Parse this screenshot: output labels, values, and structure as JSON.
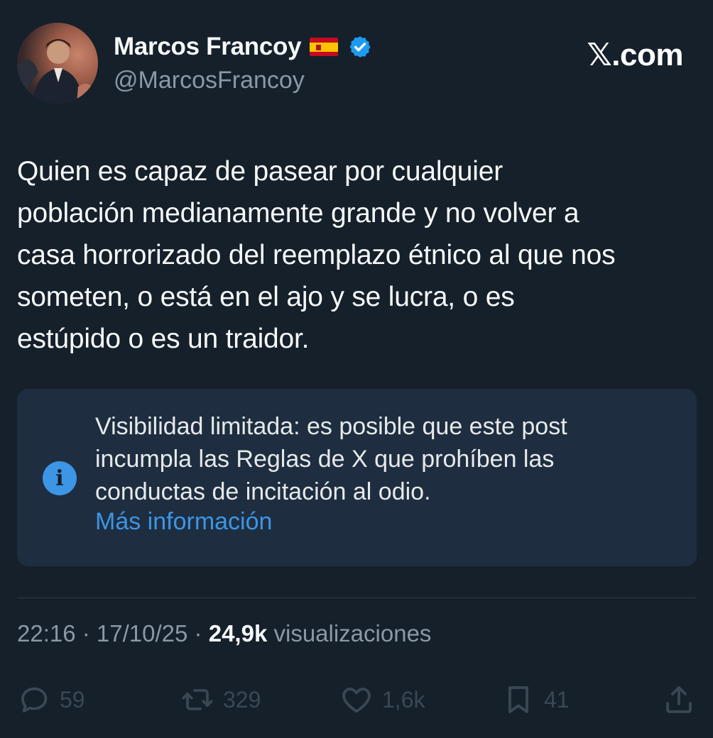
{
  "author": {
    "name": "Marcos Francoy",
    "handle": "@MarcosFrancoy",
    "flag_icon": "spain-flag-icon",
    "verified_icon": "verified-badge-icon",
    "verified_color": "#1d9bf0"
  },
  "brand": "𝕏.com",
  "tweet": {
    "text": "Quien es capaz de pasear por cualquier\npoblación medianamente grande y no volver a\ncasa horrorizado del reemplazo étnico al que nos\nsometen, o está en el ajo y se lucra, o es\nestúpido o es un traidor."
  },
  "notice": {
    "icon": "info-icon",
    "text": "Visibilidad limitada: es posible que este post\nincumpla las Reglas de X que prohíben las\nconductas de incitación al odio.",
    "link": "Más información"
  },
  "meta": {
    "time": "22:16",
    "sep1": " · ",
    "date": "17/10/25",
    "sep2": " · ",
    "views": "24,9k",
    "views_label": " visualizaciones"
  },
  "actions": {
    "replies": "59",
    "reposts": "329",
    "likes": "1,6k",
    "bookmarks": "41"
  },
  "colors": {
    "background": "#15202b",
    "secondary_text": "#8b98a5",
    "link": "#3d95e6",
    "notice_bg": "#1e2e40",
    "action_icons": "#3b4854"
  }
}
